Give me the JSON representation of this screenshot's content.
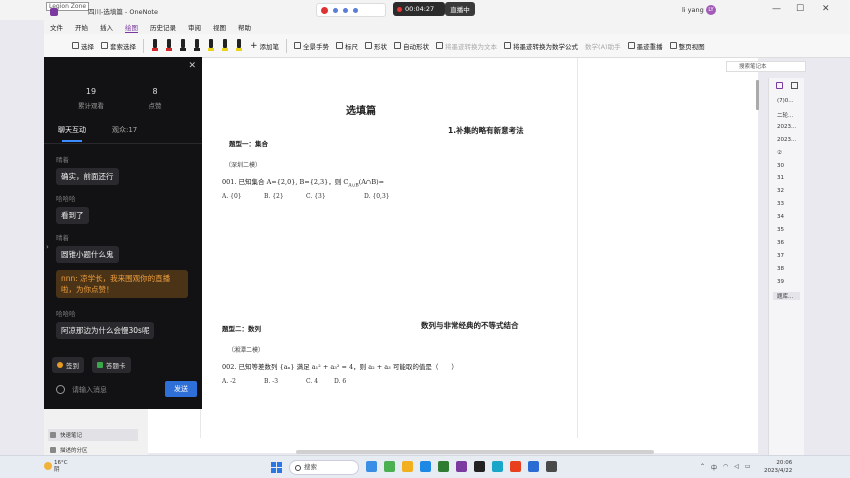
{
  "titlebar": {
    "overlay_label": "Legion Zone",
    "doc_title": "四川-选填篇",
    "app_name": "OneNote",
    "record_time": "00:04:27",
    "live_label": "直播中",
    "user_name": "li yang",
    "avatar_initials": "LY",
    "win_minimize": "—",
    "win_maximize": "☐",
    "win_close": "✕"
  },
  "menu": [
    "文件",
    "开始",
    "插入",
    "绘图",
    "历史记录",
    "审阅",
    "视图",
    "帮助"
  ],
  "menu_active": 3,
  "ribbon": {
    "select": "选择",
    "lasso": "套索选择",
    "add_pen": "添加笔",
    "full_page": "全景手势",
    "ruler": "标尺",
    "shapes": "形状",
    "auto_shape": "自动形状",
    "ink_to_text": "将墨迹转换为文本",
    "ink_to_math": "将墨迹转换为数学公式",
    "math_assist": "数学(A)助手",
    "ink_replay": "墨迹重播",
    "page_view": "整页视图",
    "pen_colors": [
      "#d62828",
      "#d62828",
      "#222222",
      "#222222",
      "#e8d21a",
      "#e8d21a",
      "#e8d21a"
    ]
  },
  "chat": {
    "stats": [
      {
        "value": "19",
        "label": "累计观看"
      },
      {
        "value": "8",
        "label": "点赞"
      }
    ],
    "tab_chat": "聊天互动",
    "tab_viewers": "观众:17",
    "messages": [
      {
        "name": "晴着",
        "text": "确实，前面还行"
      },
      {
        "name": "哈哈哈",
        "text": "看到了"
      },
      {
        "name": "晴着",
        "text": "圆锥小题什么鬼"
      },
      {
        "name": "",
        "text": "nnn: 凉学长，我来围观你的直播啦，为你点赞！"
      },
      {
        "name": "哈哈哈",
        "text": "阿凉那边为什么会慢30s呢"
      }
    ],
    "checkin": "签到",
    "answer_card": "答题卡",
    "input_placeholder": "请输入消息",
    "send": "发送"
  },
  "leftnav": {
    "quick_notes": "快速笔记",
    "recent_sections": "描述的分区"
  },
  "page": {
    "title": "选填篇",
    "subtitle1": "1.补集的略有新意考法",
    "type1": "题型一：集合",
    "source1": "（深圳二模）",
    "q1": "001. 已知集合 A={2,0}, B={2,3}，则 C",
    "q1_sub": "A∪B",
    "q1_tail": "(A∩B)=",
    "q1_options": [
      "A. {0}",
      "B. {2}",
      "C. {3}",
      "D. {0,3}"
    ],
    "type2": "题型二：数列",
    "subtitle2": "数列与非常经典的不等式结合",
    "source2": "（湘潭二模）",
    "q2": "002. 已知等差数列 {aₙ} 满足 a₁² + a₃² = 4，则 a₂ + a₃ 可能取的值是（　　）",
    "q2_options": [
      "A. -2",
      "B. -3",
      "C. 4",
      "D. 6"
    ]
  },
  "notes_search": "搜索笔记本",
  "pages_list": [
    "(7)0...",
    "二轮...",
    "2023...",
    "2023...",
    "②",
    "30",
    "31",
    "32",
    "33",
    "34",
    "35",
    "36",
    "37",
    "38",
    "39",
    "题库..."
  ],
  "pages_selected": 15,
  "taskbar": {
    "temp": "16°C",
    "weather": "阴",
    "search": "搜索",
    "time": "20:06",
    "date": "2023/4/22",
    "tray_lang": "中",
    "app_colors": [
      "#3a8ee6",
      "#4caf50",
      "#f2b01e",
      "#1e88e5",
      "#2e7d32",
      "#7a3aa0",
      "#222222",
      "#1aa6c8",
      "#e8401c",
      "#2b6cd4",
      "#4a4a4a"
    ]
  }
}
